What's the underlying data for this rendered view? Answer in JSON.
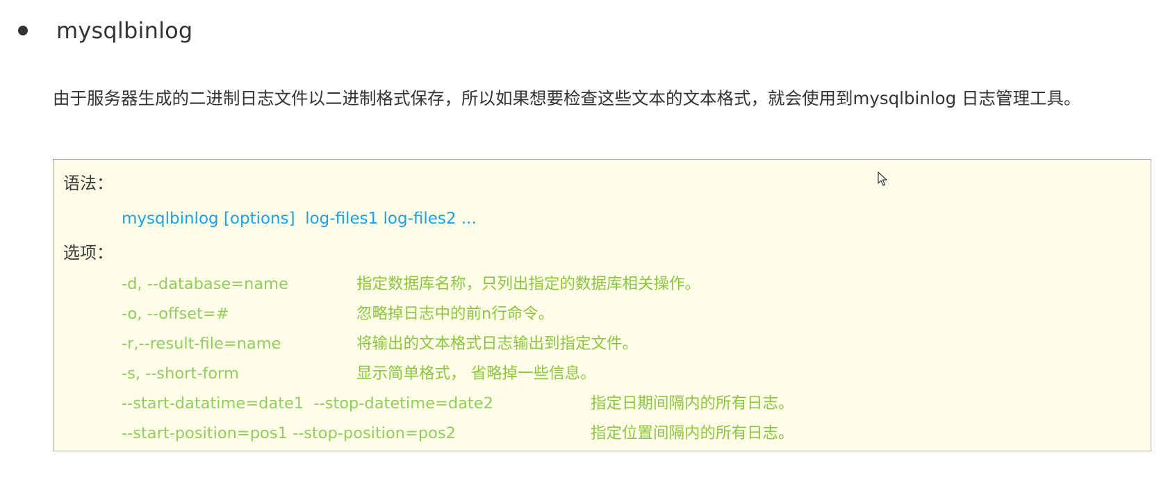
{
  "heading": {
    "bullet": "●",
    "title": "mysqlbinlog"
  },
  "description": "由于服务器生成的二进制日志文件以二进制格式保存，所以如果想要检查这些文本的文本格式，就会使用到mysqlbinlog 日志管理工具。",
  "box": {
    "syntax_label": "语法：",
    "syntax": "mysqlbinlog [options]  log-files1 log-files2 ...",
    "options_label": "选项：",
    "options": [
      {
        "flag": "-d, --database=name",
        "desc": "指定数据库名称，只列出指定的数据库相关操作。"
      },
      {
        "flag": "-o, --offset=#",
        "desc": "忽略掉日志中的前n行命令。"
      },
      {
        "flag": "-r,--result-file=name",
        "desc": "将输出的文本格式日志输出到指定文件。"
      },
      {
        "flag": "-s, --short-form",
        "desc": "显示简单格式， 省略掉一些信息。"
      },
      {
        "flag": "--start-datatime=date1  --stop-datetime=date2",
        "desc": "指定日期间隔内的所有日志。"
      },
      {
        "flag": "--start-position=pos1 --stop-position=pos2",
        "desc": "指定位置间隔内的所有日志。"
      }
    ]
  },
  "colors": {
    "text": "#333333",
    "box_background": "#fdfde8",
    "box_border": "#a6a6a6",
    "syntax": "#1ea0e6",
    "option": "#92cd5e"
  },
  "icons": {
    "cursor": "mouse-pointer-icon"
  }
}
